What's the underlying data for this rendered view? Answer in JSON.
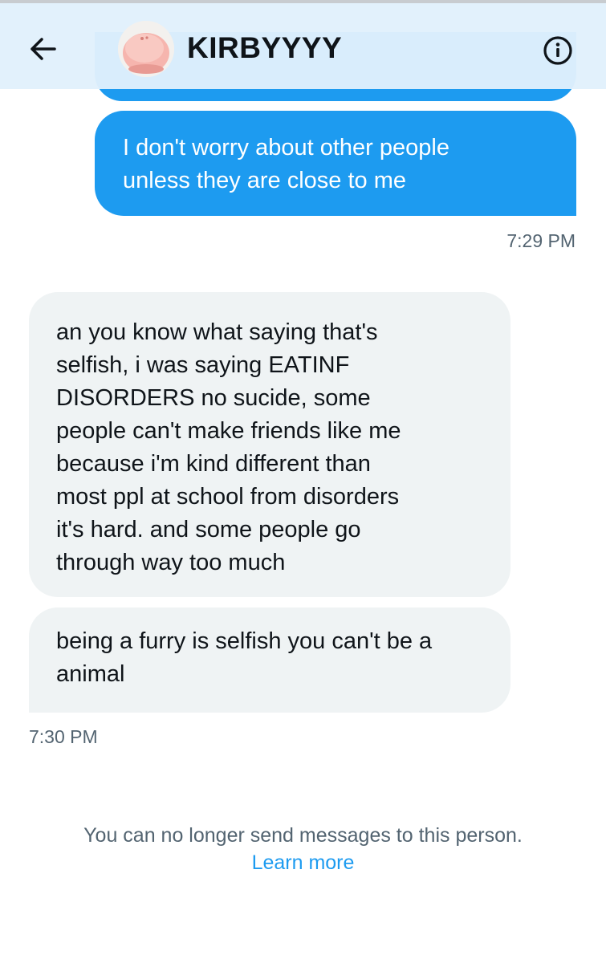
{
  "header": {
    "title": "KIRBYYYY",
    "back_icon": "arrow-left-icon",
    "info_icon": "info-circle-icon",
    "avatar": "kirby-avatar"
  },
  "messages": [
    {
      "direction": "sent",
      "text": "I don't worry about other people\nunless they are close to me",
      "time": "7:29 PM"
    },
    {
      "direction": "received",
      "text": "an you know what saying that's\nselfish, i was saying EATINF\nDISORDERS no sucide, some\npeople can't make friends like me\nbecause i'm kind different than\nmost ppl at school from disorders\nit's hard. and some people go\nthrough way too much"
    },
    {
      "direction": "received",
      "text": "being a furry is selfish you can't be a\nanimal",
      "time": "7:30 PM"
    }
  ],
  "footer": {
    "notice": "You can no longer send messages to this person.",
    "link": "Learn more"
  },
  "colors": {
    "accent": "#1d9bf0",
    "received_bubble": "#eff3f4",
    "header_bg": "#e1f0fc",
    "secondary_text": "#536471"
  }
}
